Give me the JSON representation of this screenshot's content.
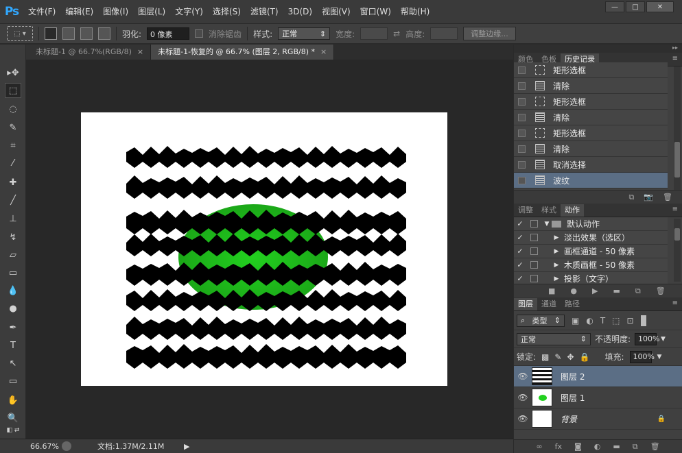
{
  "app": {
    "logo": "Ps"
  },
  "menu": [
    "文件(F)",
    "编辑(E)",
    "图像(I)",
    "图层(L)",
    "文字(Y)",
    "选择(S)",
    "滤镜(T)",
    "3D(D)",
    "视图(V)",
    "窗口(W)",
    "帮助(H)"
  ],
  "window_buttons": {
    "minimize": "—",
    "restore": "□",
    "close": "✕"
  },
  "options": {
    "feather_label": "羽化:",
    "feather_value": "0 像素",
    "antialias_label": "消除锯齿",
    "style_label": "样式:",
    "style_value": "正常",
    "width_label": "宽度:",
    "height_label": "高度:",
    "refine_button": "调整边缘..."
  },
  "tabs": [
    {
      "label": "未标题-1 @ 66.7%(RGB/8)",
      "close": "×",
      "active": false
    },
    {
      "label": "未标题-1-恢复的 @ 66.7% (图层 2, RGB/8) *",
      "close": "×",
      "active": true
    }
  ],
  "status": {
    "zoom": "66.67%",
    "doc": "文档:1.37M/2.11M",
    "arrow": "▶"
  },
  "history_panel": {
    "tabs": [
      "颜色",
      "色板",
      "历史记录"
    ],
    "items": [
      {
        "label": "矩形选框",
        "icon": "marquee"
      },
      {
        "label": "清除",
        "icon": "doc"
      },
      {
        "label": "矩形选框",
        "icon": "marquee"
      },
      {
        "label": "清除",
        "icon": "doc"
      },
      {
        "label": "矩形选框",
        "icon": "marquee"
      },
      {
        "label": "清除",
        "icon": "doc"
      },
      {
        "label": "取消选择",
        "icon": "doc"
      },
      {
        "label": "波纹",
        "icon": "doc",
        "selected": true
      }
    ]
  },
  "actions_panel": {
    "tabs": [
      "调整",
      "样式",
      "动作"
    ],
    "items": [
      {
        "label": "默认动作",
        "check": "✓",
        "folder": true,
        "expanded": true
      },
      {
        "label": "淡出效果（选区）",
        "check": "✓"
      },
      {
        "label": "画框通道 - 50 像素",
        "check": "✓"
      },
      {
        "label": "木质画框 - 50 像素",
        "check": "✓"
      },
      {
        "label": "投影（文字）",
        "check": "✓"
      }
    ]
  },
  "layers_panel": {
    "tabs": [
      "图层",
      "通道",
      "路径"
    ],
    "filter_label": "类型",
    "blend_mode": "正常",
    "opacity_label": "不透明度:",
    "opacity_value": "100%",
    "lock_label": "锁定:",
    "fill_label": "填充:",
    "fill_value": "100%",
    "layers": [
      {
        "name": "图层 2",
        "selected": true
      },
      {
        "name": "图层 1",
        "selected": false
      },
      {
        "name": "背景",
        "selected": false
      }
    ]
  },
  "colors": {
    "selection": "#5b6e85",
    "accent": "#31a8ff",
    "ellipse": "#22d11f"
  }
}
